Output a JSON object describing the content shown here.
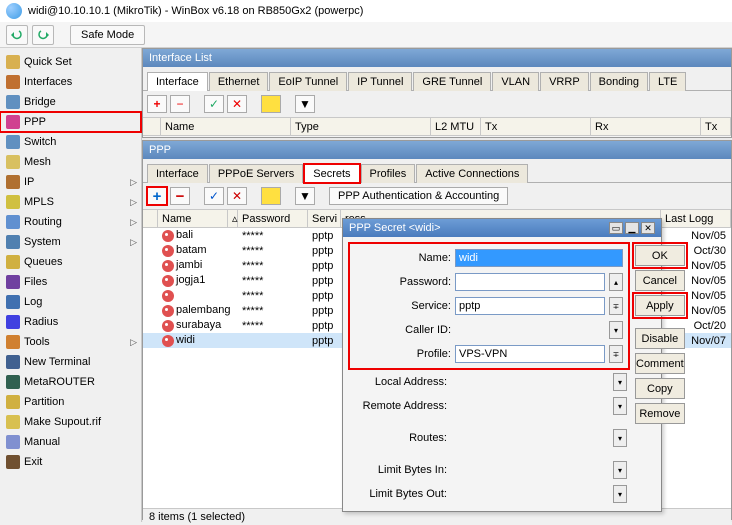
{
  "title": "widi@10.10.10.1 (MikroTik) - WinBox v6.18 on RB850Gx2 (powerpc)",
  "toolbar": {
    "safe_mode": "Safe Mode"
  },
  "sidebar": {
    "items": [
      {
        "label": "Quick Set",
        "arrow": false
      },
      {
        "label": "Interfaces",
        "arrow": false
      },
      {
        "label": "Bridge",
        "arrow": false
      },
      {
        "label": "PPP",
        "arrow": false,
        "hl": true
      },
      {
        "label": "Switch",
        "arrow": false
      },
      {
        "label": "Mesh",
        "arrow": false
      },
      {
        "label": "IP",
        "arrow": true
      },
      {
        "label": "MPLS",
        "arrow": true
      },
      {
        "label": "Routing",
        "arrow": true
      },
      {
        "label": "System",
        "arrow": true
      },
      {
        "label": "Queues",
        "arrow": false
      },
      {
        "label": "Files",
        "arrow": false
      },
      {
        "label": "Log",
        "arrow": false
      },
      {
        "label": "Radius",
        "arrow": false
      },
      {
        "label": "Tools",
        "arrow": true
      },
      {
        "label": "New Terminal",
        "arrow": false
      },
      {
        "label": "MetaROUTER",
        "arrow": false
      },
      {
        "label": "Partition",
        "arrow": false
      },
      {
        "label": "Make Supout.rif",
        "arrow": false
      },
      {
        "label": "Manual",
        "arrow": false
      },
      {
        "label": "Exit",
        "arrow": false
      }
    ]
  },
  "iface_win": {
    "title": "Interface List",
    "tabs": [
      "Interface",
      "Ethernet",
      "EoIP Tunnel",
      "IP Tunnel",
      "GRE Tunnel",
      "VLAN",
      "VRRP",
      "Bonding",
      "LTE"
    ],
    "cols": [
      "Name",
      "Type",
      "L2 MTU",
      "Tx",
      "Rx",
      "Tx"
    ]
  },
  "ppp_win": {
    "title": "PPP",
    "tabs": [
      "Interface",
      "PPPoE Servers",
      "Secrets",
      "Profiles",
      "Active Connections"
    ],
    "auth_btn": "PPP Authentication & Accounting",
    "cols": {
      "name": "Name",
      "password": "Password",
      "service": "Servi",
      "ress": "ress",
      "lastlog": "Last Logg"
    },
    "rows": [
      {
        "name": "bali",
        "password": "*****",
        "service": "pptp",
        "last": "Nov/05"
      },
      {
        "name": "batam",
        "password": "*****",
        "service": "pptp",
        "last": "Oct/30"
      },
      {
        "name": "jambi",
        "password": "*****",
        "service": "pptp",
        "last": "Nov/05"
      },
      {
        "name": "jogja1",
        "password": "*****",
        "service": "pptp",
        "last": "Nov/05"
      },
      {
        "name": "",
        "password": "*****",
        "service": "pptp",
        "last": "Nov/05"
      },
      {
        "name": "palembang",
        "password": "*****",
        "service": "pptp",
        "last": "Nov/05"
      },
      {
        "name": "surabaya",
        "password": "*****",
        "service": "pptp",
        "last": "Oct/20"
      },
      {
        "name": "widi",
        "password": "",
        "service": "pptp",
        "last": "Nov/07",
        "sel": true
      }
    ],
    "status": "8 items (1 selected)"
  },
  "dialog": {
    "title": "PPP Secret <widi>",
    "fields": {
      "name_lbl": "Name:",
      "name": "widi",
      "password_lbl": "Password:",
      "password": "",
      "service_lbl": "Service:",
      "service": "pptp",
      "caller_lbl": "Caller ID:",
      "caller": "",
      "profile_lbl": "Profile:",
      "profile": "VPS-VPN",
      "local_lbl": "Local Address:",
      "local": "",
      "remote_lbl": "Remote Address:",
      "remote": "",
      "routes_lbl": "Routes:",
      "routes": "",
      "lbi_lbl": "Limit Bytes In:",
      "lbi": "",
      "lbo_lbl": "Limit Bytes Out:",
      "lbo": ""
    },
    "buttons": {
      "ok": "OK",
      "cancel": "Cancel",
      "apply": "Apply",
      "disable": "Disable",
      "comment": "Comment",
      "copy": "Copy",
      "remove": "Remove"
    }
  }
}
